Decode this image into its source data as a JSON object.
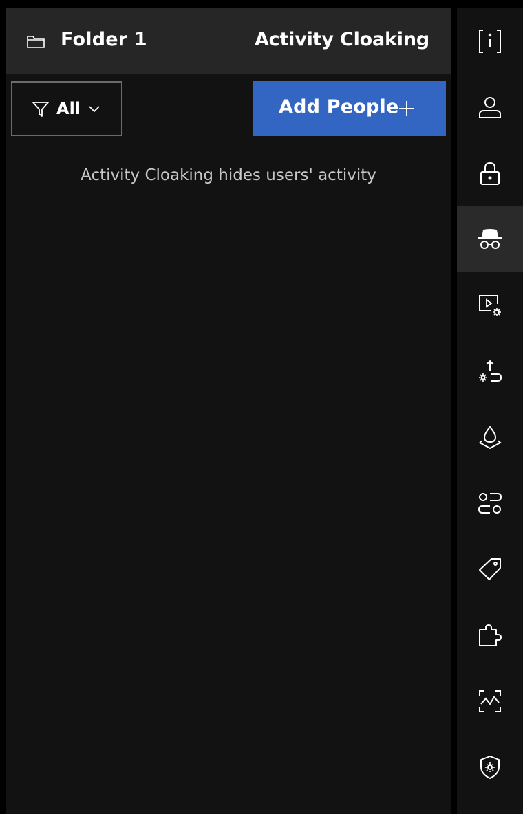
{
  "header": {
    "folder_name": "Folder 1",
    "title": "Activity Cloaking",
    "folder_icon": "folder-icon"
  },
  "toolbar": {
    "filter_label": "All",
    "filter_icon": "filter-icon",
    "add_label": "Add People",
    "add_icon": "plus-icon"
  },
  "empty_state": {
    "message": "Activity Cloaking hides users' activity"
  },
  "rail": {
    "items": [
      {
        "icon": "info-icon",
        "active": false
      },
      {
        "icon": "user-icon",
        "active": false
      },
      {
        "icon": "lock-icon",
        "active": false
      },
      {
        "icon": "incognito-icon",
        "active": true
      },
      {
        "icon": "video-settings-icon",
        "active": false
      },
      {
        "icon": "upload-settings-icon",
        "active": false
      },
      {
        "icon": "watermark-drop-icon",
        "active": false
      },
      {
        "icon": "toggles-icon",
        "active": false
      },
      {
        "icon": "tag-icon",
        "active": false
      },
      {
        "icon": "puzzle-icon",
        "active": false
      },
      {
        "icon": "activity-scan-icon",
        "active": false
      },
      {
        "icon": "shield-gear-icon",
        "active": false
      }
    ]
  },
  "colors": {
    "accent": "#3366c2",
    "panel_bg": "#121212",
    "header_bg": "#262626",
    "active_rail_bg": "#2a2a2a"
  }
}
